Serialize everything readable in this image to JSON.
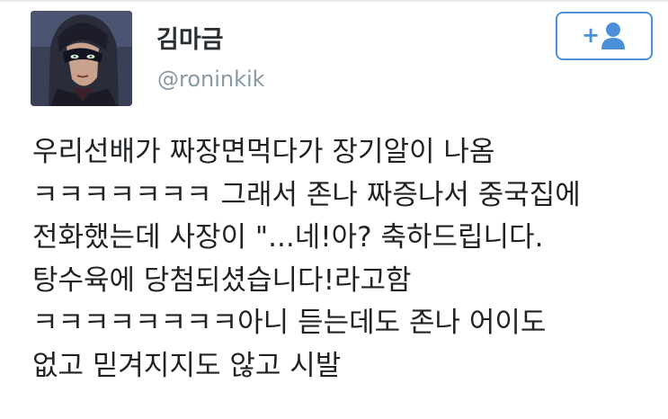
{
  "author": {
    "display_name": "김마금",
    "handle": "@roninkik",
    "avatar_icon": "masked-character-avatar"
  },
  "follow_button": {
    "icons": [
      "plus-icon",
      "person-icon"
    ],
    "plus_glyph": "+",
    "color": "#4a90d8"
  },
  "tweet": {
    "lines": [
      "우리선배가 짜장면먹다가 장기알이 나옴",
      "ㅋㅋㅋㅋㅋㅋㅋ 그래서 존나 짜증나서 중국집에",
      "전화했는데 사장이 \"...네!아? 축하드립니다.",
      "탕수육에 당첨되셨습니다!라고함",
      "ㅋㅋㅋㅋㅋㅋㅋㅋ아니 듣는데도 존나 어이도",
      "없고 믿겨지지도 않고 시발"
    ]
  },
  "colors": {
    "name_text": "#292f33",
    "handle_text": "#8899a6",
    "body_text": "#1f2326",
    "accent": "#4a90d8"
  }
}
